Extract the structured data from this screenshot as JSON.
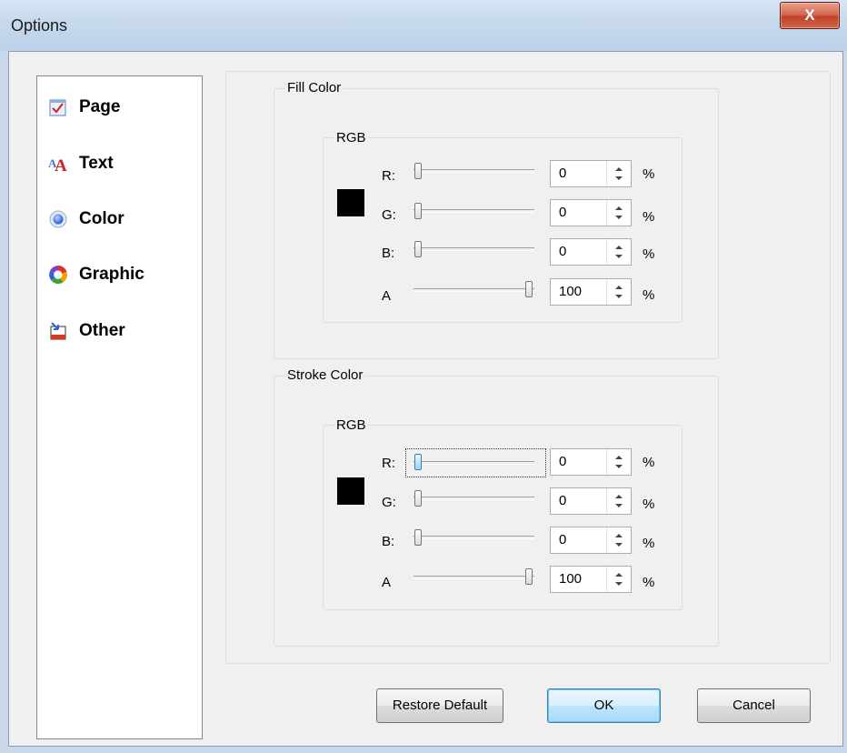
{
  "window": {
    "title": "Options",
    "close_glyph": "X"
  },
  "nav": {
    "items": [
      {
        "label": "Page",
        "icon": "page-icon"
      },
      {
        "label": "Text",
        "icon": "text-icon"
      },
      {
        "label": "Color",
        "icon": "color-icon"
      },
      {
        "label": "Graphic",
        "icon": "graphic-icon"
      },
      {
        "label": "Other",
        "icon": "other-icon"
      }
    ]
  },
  "fill": {
    "legend": "Fill Color",
    "rgb_legend": "RGB",
    "swatch_color": "#000000",
    "channels": [
      {
        "label": "R:",
        "value": "0",
        "unit": "%"
      },
      {
        "label": "G:",
        "value": "0",
        "unit": "%"
      },
      {
        "label": "B:",
        "value": "0",
        "unit": "%"
      },
      {
        "label": "A",
        "value": "100",
        "unit": "%"
      }
    ]
  },
  "stroke": {
    "legend": "Stroke Color",
    "rgb_legend": "RGB",
    "swatch_color": "#000000",
    "channels": [
      {
        "label": "R:",
        "value": "0",
        "unit": "%"
      },
      {
        "label": "G:",
        "value": "0",
        "unit": "%"
      },
      {
        "label": "B:",
        "value": "0",
        "unit": "%"
      },
      {
        "label": "A",
        "value": "100",
        "unit": "%"
      }
    ]
  },
  "buttons": {
    "restore": "Restore Default",
    "ok": "OK",
    "cancel": "Cancel"
  }
}
